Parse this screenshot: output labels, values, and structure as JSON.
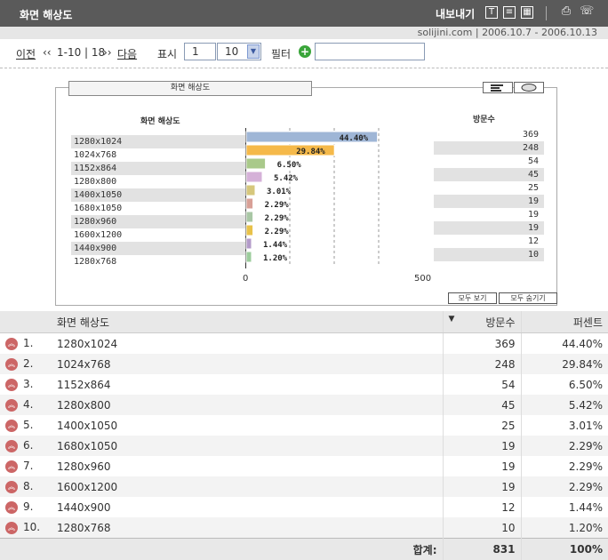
{
  "header": {
    "title": "화면 해상도",
    "export_label": "내보내기",
    "site": "solijini.com",
    "separator": "|",
    "date_range": "2006.10.7 - 2006.10.13"
  },
  "nav": {
    "prev_label": "이전",
    "prev_arrow": "‹‹",
    "page_info": "1-10 | 18",
    "next_arrow": "››",
    "next_label": "다음",
    "show_label": "표시",
    "start_value": "1",
    "rows_value": "10",
    "filter_label": "필터",
    "filter_value": ""
  },
  "chart_caption": "화면 해상도",
  "chart_data": {
    "type": "bar",
    "orientation": "horizontal",
    "category_header": "화면 해상도",
    "value_header": "방문수",
    "categories": [
      "1280x1024",
      "1024x768",
      "1152x864",
      "1280x800",
      "1400x1050",
      "1680x1050",
      "1280x960",
      "1600x1200",
      "1440x900",
      "1280x768"
    ],
    "values": [
      369,
      248,
      54,
      45,
      25,
      19,
      19,
      19,
      12,
      10
    ],
    "data_labels": [
      "44.40%",
      "29.84%",
      "6.50%",
      "5.42%",
      "3.01%",
      "2.29%",
      "2.29%",
      "2.29%",
      "1.44%",
      "1.20%"
    ],
    "xlim": [
      0,
      500
    ],
    "xticks": [
      "0",
      "500"
    ],
    "colors": [
      "#9fb6d6",
      "#f5b94a",
      "#a9c98a",
      "#d5b1d8",
      "#d6c77c",
      "#d8a097",
      "#a9c7a5",
      "#e8c24a",
      "#b39bc9",
      "#9ccc9c"
    ],
    "grid": true
  },
  "chart_buttons": {
    "show_all": "모두 보기",
    "hide_all": "모두 숨기기"
  },
  "table": {
    "col_name": "화면 해상도",
    "col_visits": "방문수",
    "col_percent": "퍼센트",
    "rows": [
      {
        "rank": "1.",
        "name": "1280x1024",
        "visits": "369",
        "percent": "44.40%"
      },
      {
        "rank": "2.",
        "name": "1024x768",
        "visits": "248",
        "percent": "29.84%"
      },
      {
        "rank": "3.",
        "name": "1152x864",
        "visits": "54",
        "percent": "6.50%"
      },
      {
        "rank": "4.",
        "name": "1280x800",
        "visits": "45",
        "percent": "5.42%"
      },
      {
        "rank": "5.",
        "name": "1400x1050",
        "visits": "25",
        "percent": "3.01%"
      },
      {
        "rank": "6.",
        "name": "1680x1050",
        "visits": "19",
        "percent": "2.29%"
      },
      {
        "rank": "7.",
        "name": "1280x960",
        "visits": "19",
        "percent": "2.29%"
      },
      {
        "rank": "8.",
        "name": "1600x1200",
        "visits": "19",
        "percent": "2.29%"
      },
      {
        "rank": "9.",
        "name": "1440x900",
        "visits": "12",
        "percent": "1.44%"
      },
      {
        "rank": "10.",
        "name": "1280x768",
        "visits": "10",
        "percent": "1.20%"
      }
    ],
    "total_label": "합계:",
    "total_visits": "831",
    "total_percent": "100%"
  }
}
